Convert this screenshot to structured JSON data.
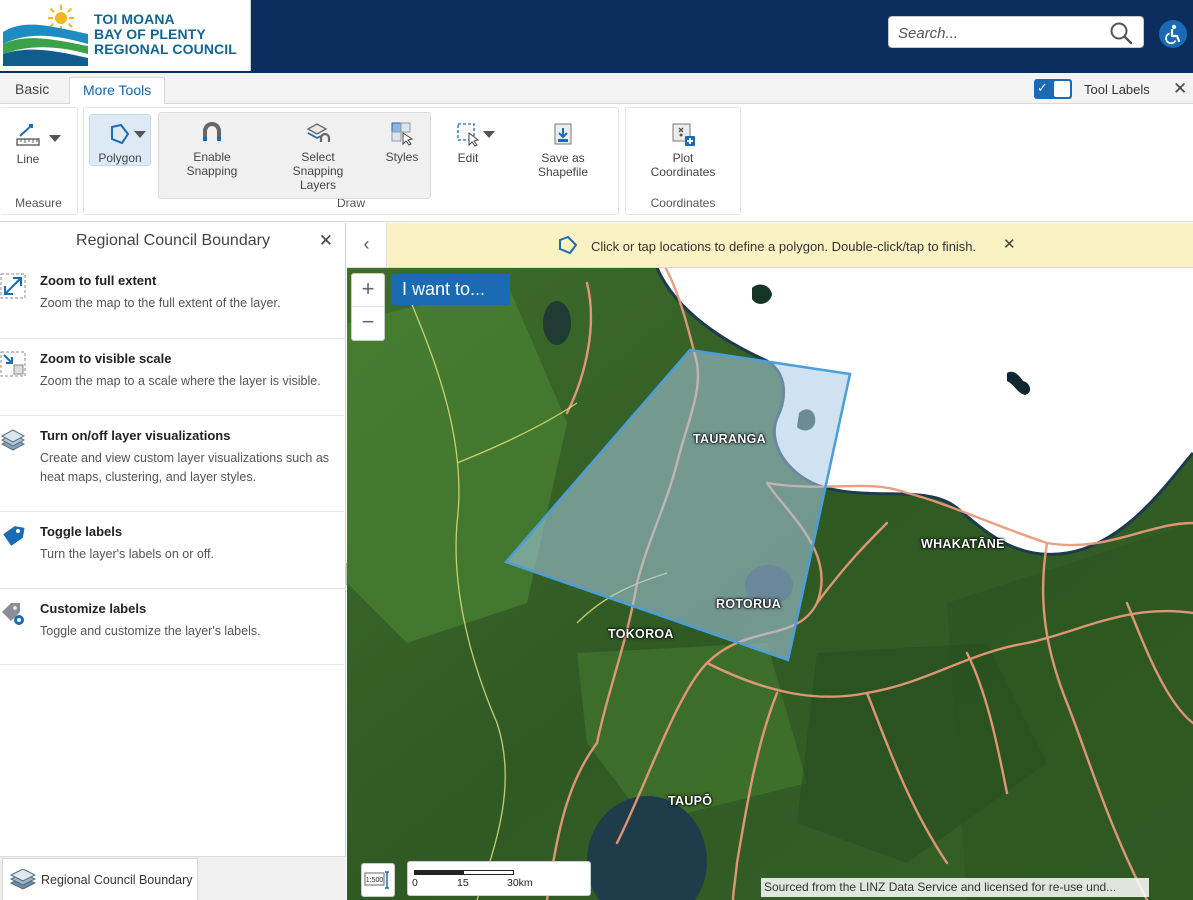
{
  "header": {
    "logo_lines": [
      "TOI MOANA",
      "BAY OF PLENTY",
      "REGIONAL COUNCIL"
    ],
    "search_placeholder": "Search..."
  },
  "tabs": {
    "basic": "Basic",
    "more_tools": "More Tools",
    "tool_labels": "Tool Labels",
    "tool_labels_on": true
  },
  "ribbon": {
    "measure": {
      "line": "Line",
      "group": "Measure"
    },
    "draw": {
      "polygon": "Polygon",
      "enable_snapping": "Enable Snapping",
      "select_snapping": "Select Snapping Layers",
      "styles": "Styles",
      "edit": "Edit",
      "save_shapefile": "Save as Shapefile",
      "group": "Draw"
    },
    "coordinates": {
      "plot": "Plot Coordinates",
      "group": "Coordinates"
    }
  },
  "panel": {
    "title": "Regional Council Boundary",
    "items": [
      {
        "title": "Zoom to full extent",
        "desc": "Zoom the map to the full extent of the layer."
      },
      {
        "title": "Zoom to visible scale",
        "desc": "Zoom the map to a scale where the layer is visible."
      },
      {
        "title": "Turn on/off layer visualizations",
        "desc": "Create and view custom layer visualizations such as heat maps, clustering, and layer styles."
      },
      {
        "title": "Toggle labels",
        "desc": "Turn the layer's labels on or off."
      },
      {
        "title": "Customize labels",
        "desc": "Toggle and customize the layer's labels."
      }
    ],
    "bottom_tab": "Regional Council Boundary"
  },
  "map": {
    "notice": "Click or tap locations to define a polygon. Double-click/tap to finish.",
    "i_want_to": "I want to...",
    "places": [
      "TAURANGA",
      "WHAKATĀNE",
      "ROTORUA",
      "TOKOROA",
      "TAUPŌ"
    ],
    "scale_button": "1:500",
    "scale_labels": [
      "0",
      "15",
      "30km"
    ],
    "attribution": "Sourced from the LINZ Data Service and licensed for re-use und..."
  },
  "colors": {
    "header_bg": "#0c2e5e",
    "accent": "#1a6bb3",
    "notice_bg": "#fbf2c4",
    "polygon_stroke": "#4a9fd8"
  }
}
